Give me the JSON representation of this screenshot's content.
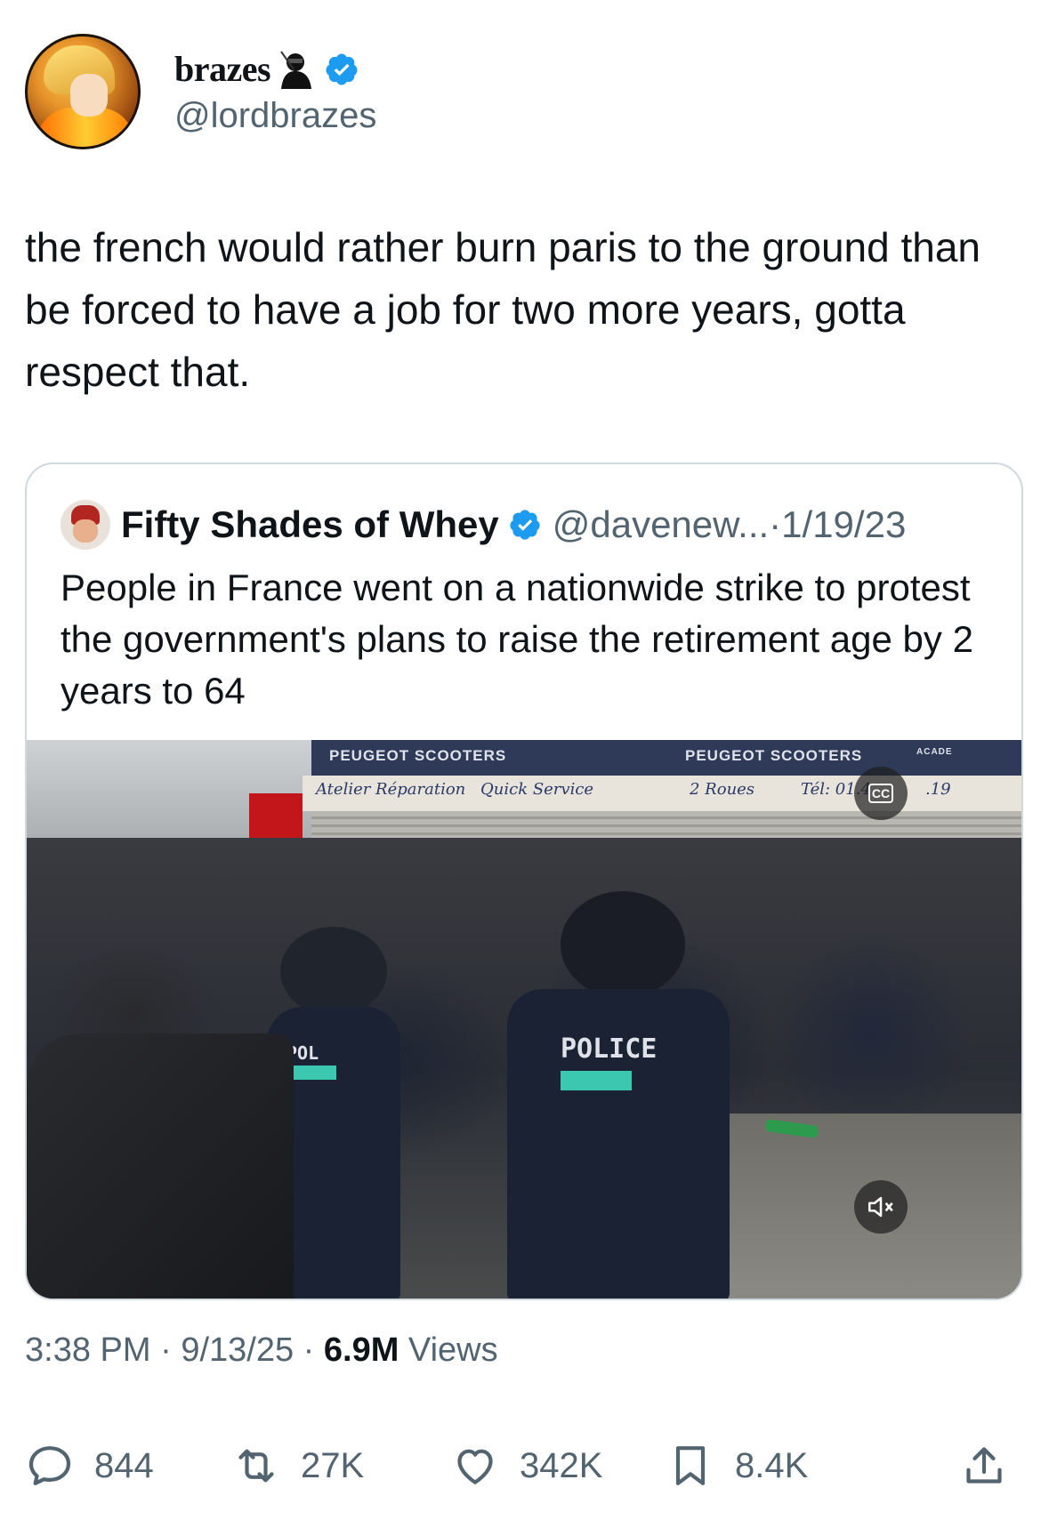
{
  "author": {
    "display_name": "brazes",
    "handle": "@lordbrazes",
    "verified": true
  },
  "tweet": {
    "text": "the french would rather burn paris to the ground than be forced to have a job for two more years, gotta respect that."
  },
  "quoted_tweet": {
    "display_name": "Fifty Shades of Whey",
    "handle": "@davenew...",
    "separator": "·",
    "date": "1/19/23",
    "text": "People in France went on a nationwide strike to protest the government's plans to raise the retirement age by 2 years to 64",
    "media": {
      "type": "video",
      "sign_left": "PEUGEOT SCOOTERS",
      "sign_right": "PEUGEOT SCOOTERS",
      "sign_right_extra": "ACADE",
      "band_left_1": "Atelier Réparation",
      "band_left_2": "Quick Service",
      "band_right_1": "2 Roues",
      "band_right_2": "Tél: 01.4",
      "band_right_3": ".19",
      "vest_label_main": "POLICE",
      "vest_label_left": "POL",
      "cc_label": "CC",
      "mute_icon": "volume-muted-icon"
    }
  },
  "meta": {
    "time": "3:38 PM",
    "sep1": " · ",
    "date": "9/13/25",
    "sep2": " · ",
    "views_count": "6.9M",
    "views_label": " Views"
  },
  "actions": {
    "replies": "844",
    "reposts": "27K",
    "likes": "342K",
    "bookmarks": "8.4K"
  },
  "colors": {
    "text_primary": "#0f1419",
    "text_secondary": "#536471",
    "verified_blue": "#1d9bf0",
    "border": "#cfd9de"
  }
}
